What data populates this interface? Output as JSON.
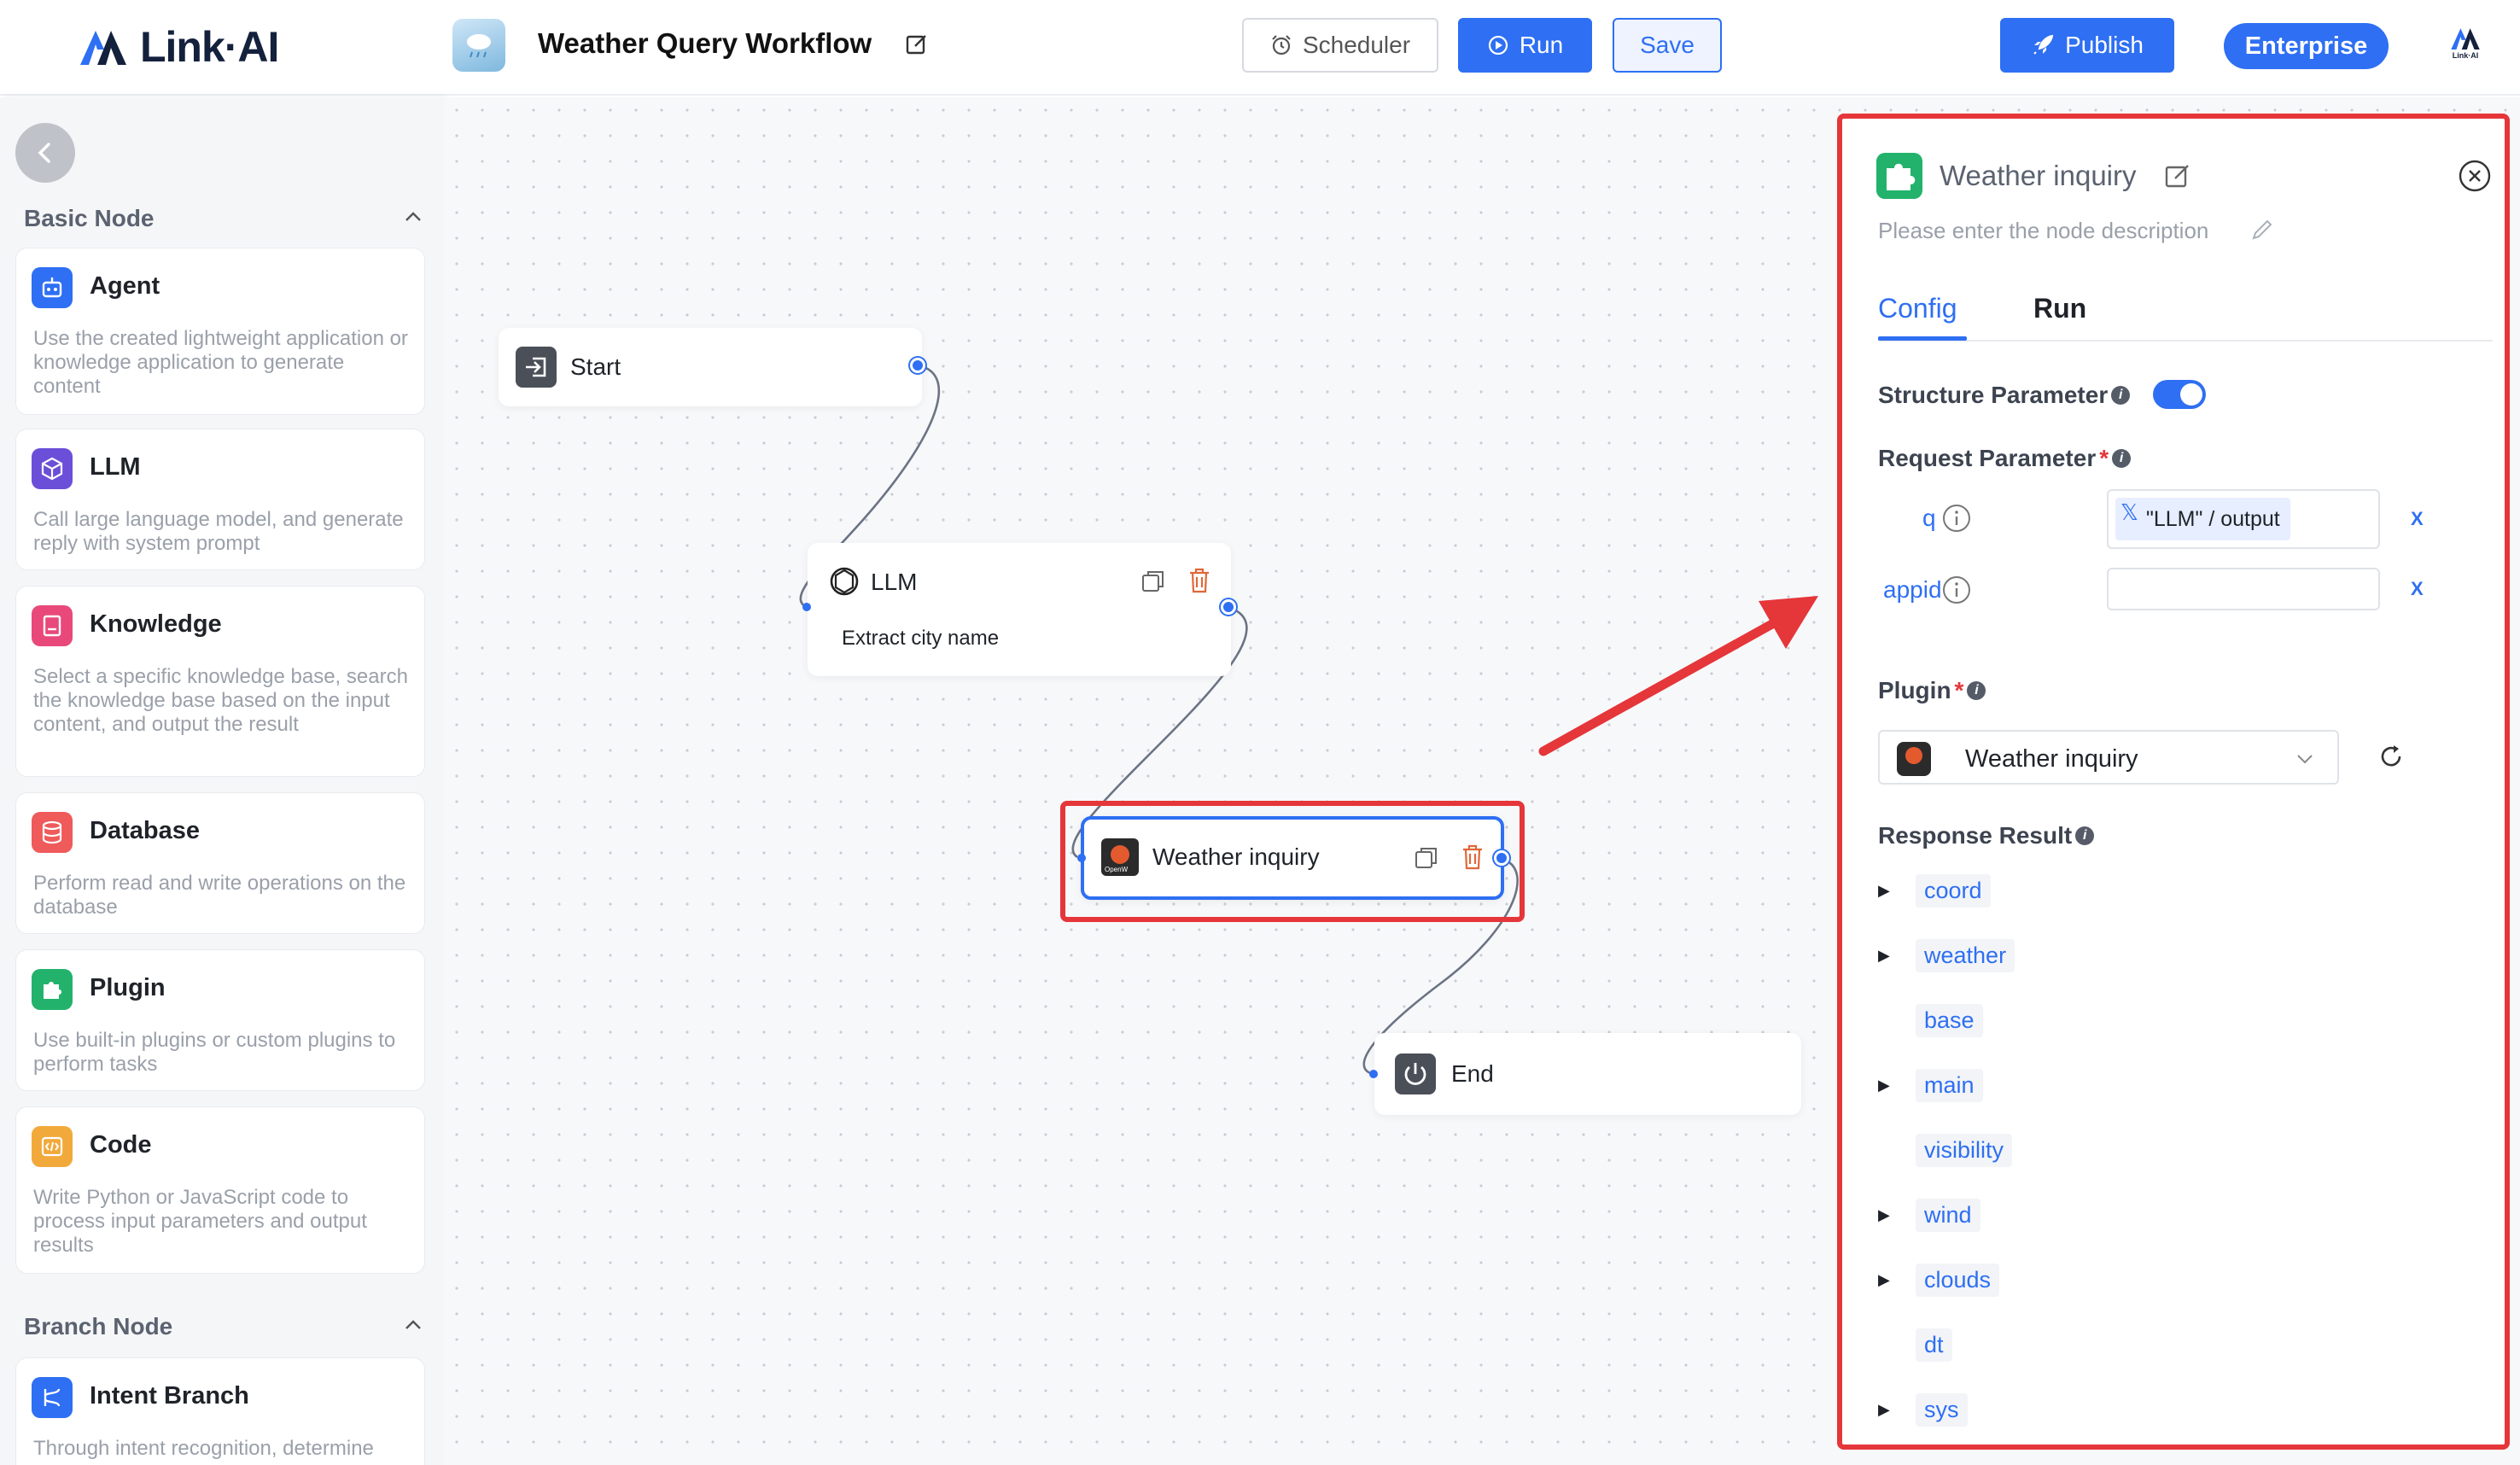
{
  "app": {
    "logo_text": "Link·AI",
    "mini_logo_text": "Link·AI"
  },
  "header": {
    "workflow_title": "Weather Query Workflow",
    "scheduler_label": "Scheduler",
    "run_label": "Run",
    "save_label": "Save",
    "publish_label": "Publish",
    "enterprise_label": "Enterprise"
  },
  "sidebar": {
    "sections": [
      {
        "title": "Basic Node"
      },
      {
        "title": "Branch Node"
      }
    ],
    "items": [
      {
        "title": "Agent",
        "desc": "Use the created lightweight application or knowledge application to generate content"
      },
      {
        "title": "LLM",
        "desc": "Call large language model, and generate reply with system prompt"
      },
      {
        "title": "Knowledge",
        "desc": "Select a specific knowledge base, search the knowledge base based on the input content, and output the result"
      },
      {
        "title": "Database",
        "desc": "Perform read and write operations on the database"
      },
      {
        "title": "Plugin",
        "desc": "Use built-in plugins or custom plugins to perform tasks"
      },
      {
        "title": "Code",
        "desc": "Write Python or JavaScript code to process input parameters and output results"
      },
      {
        "title": "Intent Branch",
        "desc": "Through intent recognition, determine"
      }
    ]
  },
  "canvas": {
    "nodes": {
      "start": {
        "title": "Start"
      },
      "llm": {
        "title": "LLM",
        "subtitle": "Extract city name"
      },
      "weather": {
        "title": "Weather inquiry",
        "badge": "OpenW"
      },
      "end": {
        "title": "End"
      }
    }
  },
  "panel": {
    "title": "Weather inquiry",
    "description_placeholder": "Please enter the node description",
    "tabs": [
      {
        "label": "Config"
      },
      {
        "label": "Run"
      }
    ],
    "structure_parameter_label": "Structure Parameter",
    "structure_parameter_enabled": true,
    "request_parameter_label": "Request Parameter",
    "params": [
      {
        "name": "q",
        "value_chip": "\"LLM\" / output"
      },
      {
        "name": "appid",
        "value_chip": ""
      }
    ],
    "var_button": "X",
    "plugin_label": "Plugin",
    "plugin_selected": "Weather inquiry",
    "response_result_label": "Response Result",
    "response_fields": [
      {
        "name": "coord",
        "expandable": true
      },
      {
        "name": "weather",
        "expandable": true
      },
      {
        "name": "base",
        "expandable": false
      },
      {
        "name": "main",
        "expandable": true
      },
      {
        "name": "visibility",
        "expandable": false
      },
      {
        "name": "wind",
        "expandable": true
      },
      {
        "name": "clouds",
        "expandable": true
      },
      {
        "name": "dt",
        "expandable": false
      },
      {
        "name": "sys",
        "expandable": true
      }
    ]
  },
  "colors": {
    "accent": "#2e6ff3",
    "highlight": "#e5363a",
    "canvas_bg": "#f7f8fa"
  }
}
